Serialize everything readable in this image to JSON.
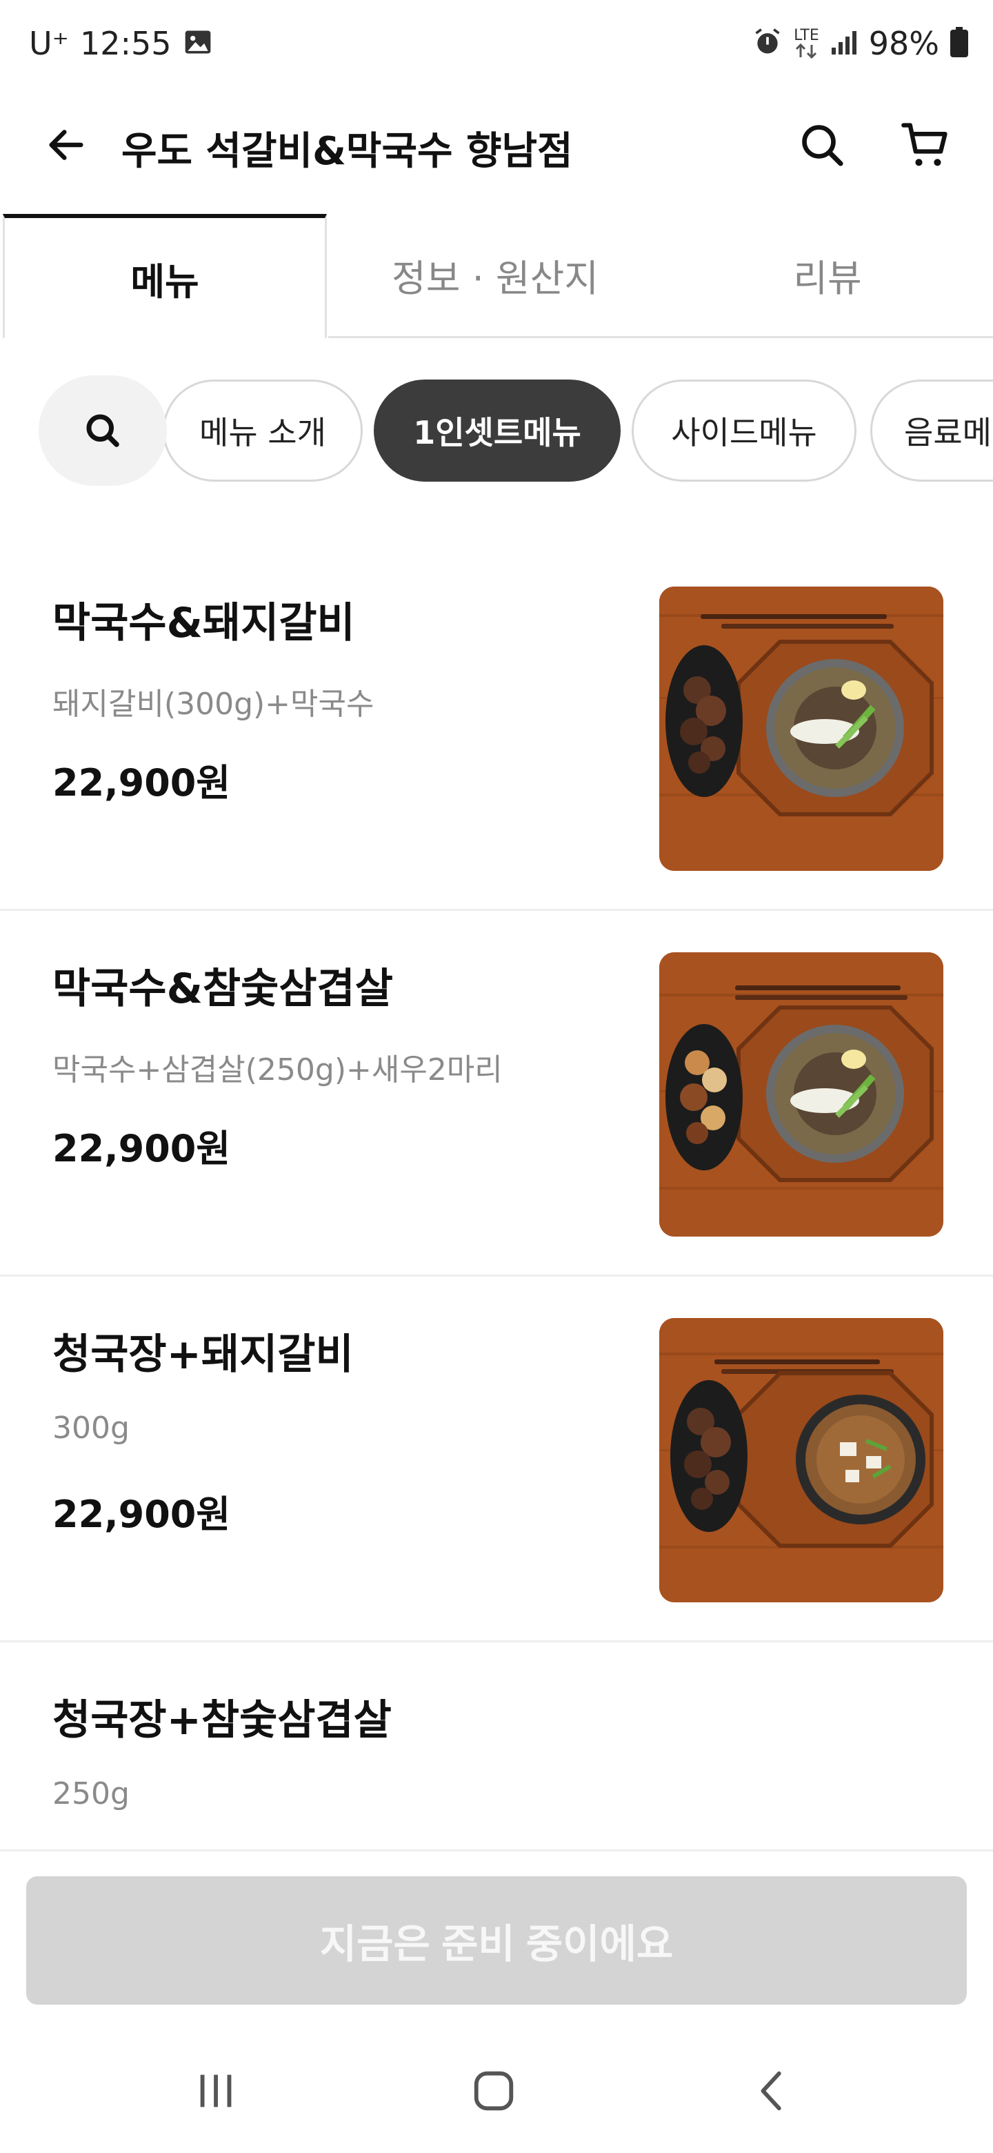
{
  "status_bar": {
    "carrier": "U⁺",
    "time": "12:55",
    "network": "LTE",
    "battery": "98%"
  },
  "header": {
    "title": "우도 석갈비&막국수 향남점"
  },
  "tabs": [
    {
      "label": "메뉴",
      "active": true
    },
    {
      "label": "정보 · 원산지",
      "active": false
    },
    {
      "label": "리뷰",
      "active": false
    }
  ],
  "categories": [
    {
      "label": "메뉴 소개",
      "active": false
    },
    {
      "label": "1인셋트메뉴",
      "active": true
    },
    {
      "label": "사이드메뉴",
      "active": false
    },
    {
      "label": "음료메",
      "active": false
    }
  ],
  "menu_items": [
    {
      "name": "막국수&돼지갈비",
      "description": "돼지갈비(300g)+막국수",
      "price": "22,900원",
      "image": "noodle-rib-set"
    },
    {
      "name": "막국수&참숯삼겹살",
      "description": "막국수+삼겹살(250g)+새우2마리",
      "price": "22,900원",
      "image": "noodle-porkbelly-set"
    },
    {
      "name": "청국장+돼지갈비",
      "description": "300g",
      "price": "22,900원",
      "image": "stew-rib-set"
    },
    {
      "name": "청국장+참숯삼겹살",
      "description": "250g",
      "price": "",
      "image": ""
    }
  ],
  "cta": {
    "label": "지금은 준비 중이에요",
    "enabled": false
  },
  "colors": {
    "active_chip": "#3c3c3c",
    "disabled_cta": "#d4d4d4",
    "wood": "#a8521f"
  }
}
